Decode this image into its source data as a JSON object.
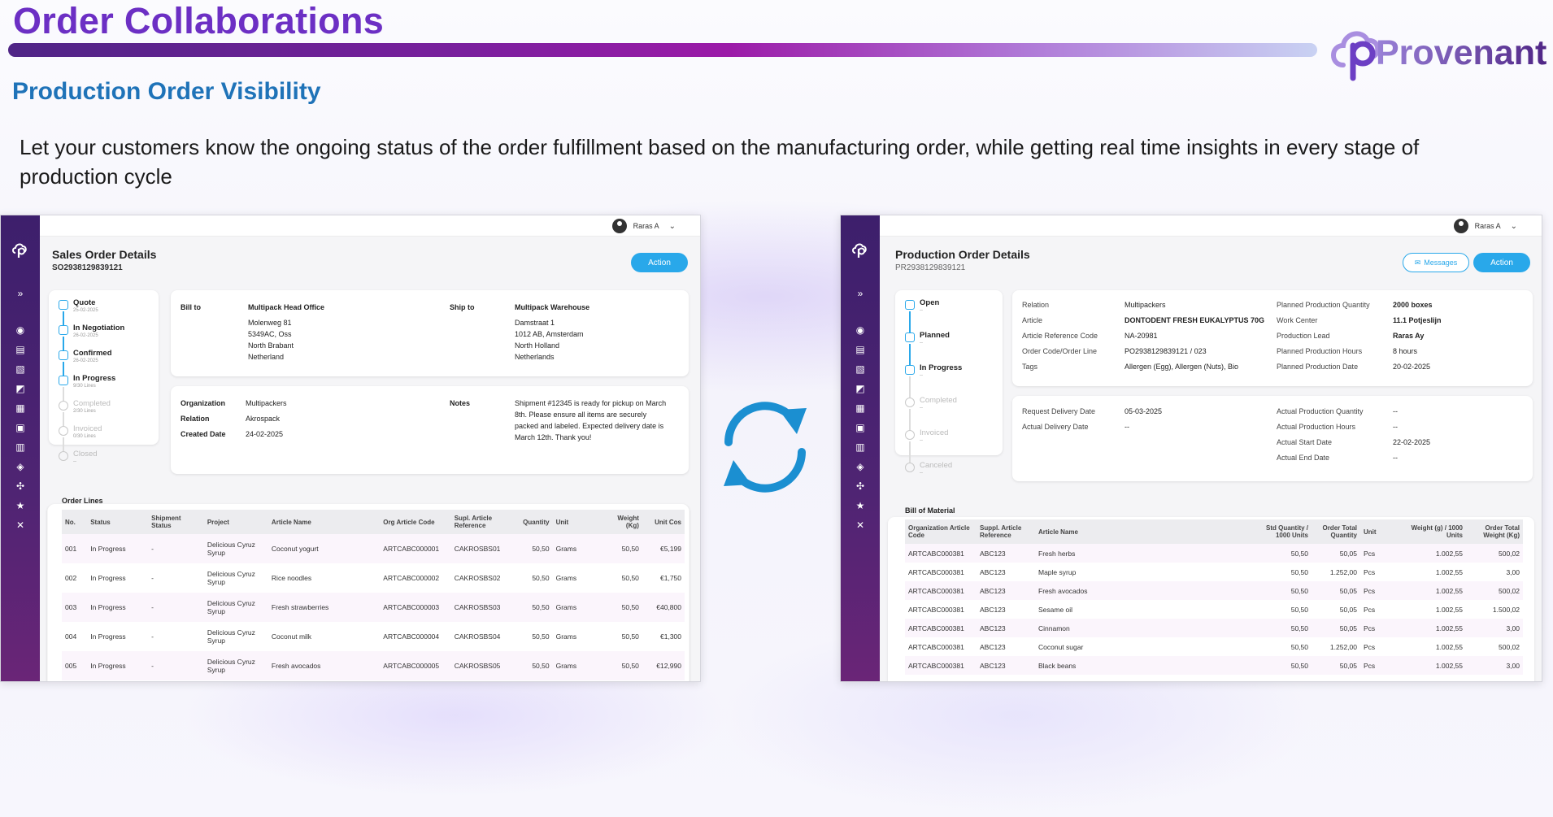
{
  "slide": {
    "title": "Order Collaborations",
    "subtitle": "Production Order Visibility",
    "description": "Let your customers know the ongoing status of the order fulfillment based on the manufacturing order, while getting real time insights in every stage of production cycle",
    "logo_text": "Provenant",
    "sync_icon": "sync-arrows-icon"
  },
  "colors": {
    "title": "#6c2fc4",
    "subtitle": "#1f73b8",
    "accent": "#29a8ea",
    "rail": "#4f2473"
  },
  "user": {
    "name": "Raras A"
  },
  "sales": {
    "title": "Sales Order Details",
    "id": "SO2938129839121",
    "action": "Action",
    "timeline": [
      {
        "label": "Quote",
        "sub": "25-02-2025",
        "done": true
      },
      {
        "label": "In Negotiation",
        "sub": "26-02-2025",
        "done": true
      },
      {
        "label": "Confirmed",
        "sub": "26-02-2025",
        "done": true
      },
      {
        "label": "In Progress",
        "sub": "9/30 Lines",
        "done": true
      },
      {
        "label": "Completed",
        "sub": "2/30 Lines",
        "done": false
      },
      {
        "label": "Invoiced",
        "sub": "0/30 Lines",
        "done": false
      },
      {
        "label": "Closed",
        "sub": "--",
        "done": false
      }
    ],
    "bill_to_label": "Bill to",
    "bill_to_name": "Multipack Head Office",
    "bill_to_lines": [
      "Molenweg 81",
      "5349AC, Oss",
      "North Brabant",
      "Netherland"
    ],
    "ship_to_label": "Ship to",
    "ship_to_name": "Multipack Warehouse",
    "ship_to_lines": [
      "Damstraat 1",
      "1012 AB, Amsterdam",
      "North Holland",
      "Netherlands"
    ],
    "org_label": "Organization",
    "org": "Multipackers",
    "relation_label": "Relation",
    "relation": "Akrospack",
    "created_label": "Created Date",
    "created": "24-02-2025",
    "notes_label": "Notes",
    "notes": "Shipment #12345 is ready for pickup on March 8th. Please ensure all items are securely packed and labeled. Expected delivery date is March 12th. Thank you!",
    "lines_title": "Order Lines",
    "columns": [
      "No.",
      "Status",
      "Shipment Status",
      "Project",
      "Article Name",
      "Org Article Code",
      "Supl. Article Reference",
      "Quantity",
      "Unit",
      "Weight (Kg)",
      "Unit Cos"
    ],
    "rows": [
      [
        "001",
        "In Progress",
        "-",
        "Delicious Cyruz Syrup",
        "Coconut yogurt",
        "ARTCABC000001",
        "CAKROSBS01",
        "50,50",
        "Grams",
        "50,50",
        "€5,199"
      ],
      [
        "002",
        "In Progress",
        "-",
        "Delicious Cyruz Syrup",
        "Rice noodles",
        "ARTCABC000002",
        "CAKROSBS02",
        "50,50",
        "Grams",
        "50,50",
        "€1,750"
      ],
      [
        "003",
        "In Progress",
        "-",
        "Delicious Cyruz Syrup",
        "Fresh strawberries",
        "ARTCABC000003",
        "CAKROSBS03",
        "50,50",
        "Grams",
        "50,50",
        "€40,800"
      ],
      [
        "004",
        "In Progress",
        "-",
        "Delicious Cyruz Syrup",
        "Coconut milk",
        "ARTCABC000004",
        "CAKROSBS04",
        "50,50",
        "Grams",
        "50,50",
        "€1,300"
      ],
      [
        "005",
        "In Progress",
        "-",
        "Delicious Cyruz Syrup",
        "Fresh avocados",
        "ARTCABC000005",
        "CAKROSBS05",
        "50,50",
        "Grams",
        "50,50",
        "€12,990"
      ]
    ]
  },
  "production": {
    "title": "Production Order Details",
    "id": "PR2938129839121",
    "messages": "Messages",
    "action": "Action",
    "timeline": [
      {
        "label": "Open",
        "sub": "--",
        "done": true
      },
      {
        "label": "Planned",
        "sub": "--",
        "done": true
      },
      {
        "label": "In Progress",
        "sub": "--",
        "done": true
      },
      {
        "label": "Completed",
        "sub": "--",
        "done": false
      },
      {
        "label": "Invoiced",
        "sub": "--",
        "done": false
      },
      {
        "label": "Canceled",
        "sub": "--",
        "done": false
      }
    ],
    "fields_a": [
      {
        "label": "Relation",
        "value": "Multipackers",
        "bold": false
      },
      {
        "label": "Article",
        "value": "DONTODENT FRESH EUKALYPTUS 70G",
        "bold": true
      },
      {
        "label": "Article Reference Code",
        "value": "NA-20981",
        "bold": false
      },
      {
        "label": "Order Code/Order Line",
        "value": "PO2938129839121 / 023",
        "bold": false
      },
      {
        "label": "Tags",
        "value": "Allergen (Egg), Allergen (Nuts), Bio",
        "bold": false
      }
    ],
    "fields_b": [
      {
        "label": "Planned Production Quantity",
        "value": "2000 boxes",
        "bold": true
      },
      {
        "label": "Work Center",
        "value": "11.1 Potjeslijn",
        "bold": true
      },
      {
        "label": "Production Lead",
        "value": "Raras Ay",
        "bold": true
      },
      {
        "label": "Planned Production Hours",
        "value": "8 hours",
        "bold": false
      },
      {
        "label": "Planned Production Date",
        "value": "20-02-2025",
        "bold": false
      }
    ],
    "fields_c": [
      {
        "label": "Request Delivery Date",
        "value": "05-03-2025"
      },
      {
        "label": "Actual Delivery Date",
        "value": "--"
      }
    ],
    "fields_d": [
      {
        "label": "Actual Production Quantity",
        "value": "--"
      },
      {
        "label": "Actual Production Hours",
        "value": "--"
      },
      {
        "label": "Actual Start Date",
        "value": "22-02-2025"
      },
      {
        "label": "Actual End Date",
        "value": "--"
      }
    ],
    "bom_title": "Bill of Material",
    "columns": [
      "Organization Article Code",
      "Suppl. Article Reference",
      "Article Name",
      "Std Quantity / 1000 Units",
      "Order Total Quantity",
      "Unit",
      "Weight (g) / 1000 Units",
      "Order Total Weight (Kg)"
    ],
    "rows": [
      [
        "ARTCABC000381",
        "ABC123",
        "Fresh herbs",
        "50,50",
        "50,05",
        "Pcs",
        "1.002,55",
        "500,02"
      ],
      [
        "ARTCABC000381",
        "ABC123",
        "Maple syrup",
        "50,50",
        "1.252,00",
        "Pcs",
        "1.002,55",
        "3,00"
      ],
      [
        "ARTCABC000381",
        "ABC123",
        "Fresh avocados",
        "50,50",
        "50,05",
        "Pcs",
        "1.002,55",
        "500,02"
      ],
      [
        "ARTCABC000381",
        "ABC123",
        "Sesame oil",
        "50,50",
        "50,05",
        "Pcs",
        "1.002,55",
        "1.500,02"
      ],
      [
        "ARTCABC000381",
        "ABC123",
        "Cinnamon",
        "50,50",
        "50,05",
        "Pcs",
        "1.002,55",
        "3,00"
      ],
      [
        "ARTCABC000381",
        "ABC123",
        "Coconut sugar",
        "50,50",
        "1.252,00",
        "Pcs",
        "1.002,55",
        "500,02"
      ],
      [
        "ARTCABC000381",
        "ABC123",
        "Black beans",
        "50,50",
        "50,05",
        "Pcs",
        "1.002,55",
        "3,00"
      ]
    ]
  }
}
